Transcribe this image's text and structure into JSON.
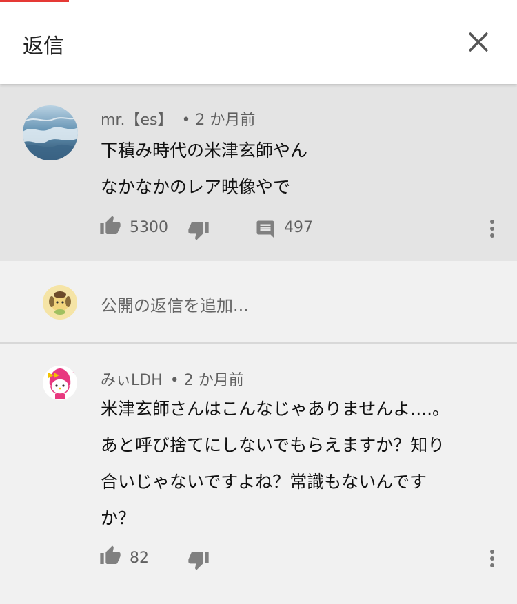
{
  "header": {
    "title": "返信",
    "close_icon": "close-icon"
  },
  "main_comment": {
    "author": "mr.【es】",
    "time": "• 2 か月前",
    "lines": [
      "下積み時代の米津玄師やん",
      "なかなかのレア映像やで"
    ],
    "likes": "5300",
    "replies": "497"
  },
  "reply_input": {
    "placeholder": "公開の返信を追加..."
  },
  "reply": {
    "author": "みぃLDH",
    "time": "• 2 か月前",
    "lines": [
      "米津玄師さんはこんなじゃありませんよ....。",
      "あと呼び捨てにしないでもらえますか？知り",
      "合いじゃないですよね？常識もないんです",
      "か？"
    ],
    "likes": "82"
  },
  "colors": {
    "accent": "#e53935",
    "icon_gray": "#808080",
    "main_bg": "#e4e4e4",
    "page_bg": "#f1f1f1"
  }
}
